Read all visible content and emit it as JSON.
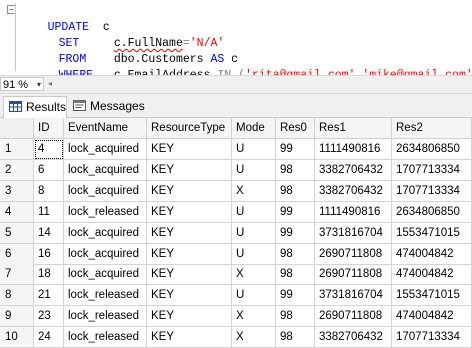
{
  "editor": {
    "lines": [
      {
        "kw": "UPDATE",
        "rest": "c"
      },
      {
        "kw": "SET",
        "col": "c.FullName",
        "op": "=",
        "str": "'N/A'"
      },
      {
        "kw": "FROM",
        "obj": "dbo.Customers",
        "as": "AS",
        "alias": "c"
      },
      {
        "kw": "WHERE",
        "col": "c.EmailAddress",
        "in": "IN",
        "open": "(",
        "s1": "'rita@gmail.com'",
        "comma": ",",
        "s2": "'mike@gmail.com'",
        "close": ")"
      }
    ],
    "collapse_glyph": "−"
  },
  "zoom": {
    "value": "91 %",
    "arrow": "▾",
    "scroll_left": "◂"
  },
  "tabs": [
    {
      "label": "Results",
      "icon": "grid-icon",
      "active": true
    },
    {
      "label": "Messages",
      "icon": "messages-icon",
      "active": false
    }
  ],
  "grid": {
    "columns": [
      "ID",
      "EventName",
      "ResourceType",
      "Mode",
      "Res0",
      "Res1",
      "Res2"
    ],
    "rows": [
      [
        "1",
        "4",
        "lock_acquired",
        "KEY",
        "U",
        "99",
        "1111490816",
        "2634806850"
      ],
      [
        "2",
        "6",
        "lock_acquired",
        "KEY",
        "U",
        "98",
        "3382706432",
        "1707713334"
      ],
      [
        "3",
        "8",
        "lock_acquired",
        "KEY",
        "X",
        "98",
        "3382706432",
        "1707713334"
      ],
      [
        "4",
        "11",
        "lock_released",
        "KEY",
        "U",
        "99",
        "1111490816",
        "2634806850"
      ],
      [
        "5",
        "14",
        "lock_acquired",
        "KEY",
        "U",
        "99",
        "3731816704",
        "1553471015"
      ],
      [
        "6",
        "16",
        "lock_acquired",
        "KEY",
        "U",
        "98",
        "2690711808",
        "474004842"
      ],
      [
        "7",
        "18",
        "lock_acquired",
        "KEY",
        "X",
        "98",
        "2690711808",
        "474004842"
      ],
      [
        "8",
        "21",
        "lock_released",
        "KEY",
        "U",
        "99",
        "3731816704",
        "1553471015"
      ],
      [
        "9",
        "23",
        "lock_released",
        "KEY",
        "X",
        "98",
        "2690711808",
        "474004842"
      ],
      [
        "10",
        "24",
        "lock_released",
        "KEY",
        "X",
        "98",
        "3382706432",
        "1707713334"
      ]
    ]
  }
}
